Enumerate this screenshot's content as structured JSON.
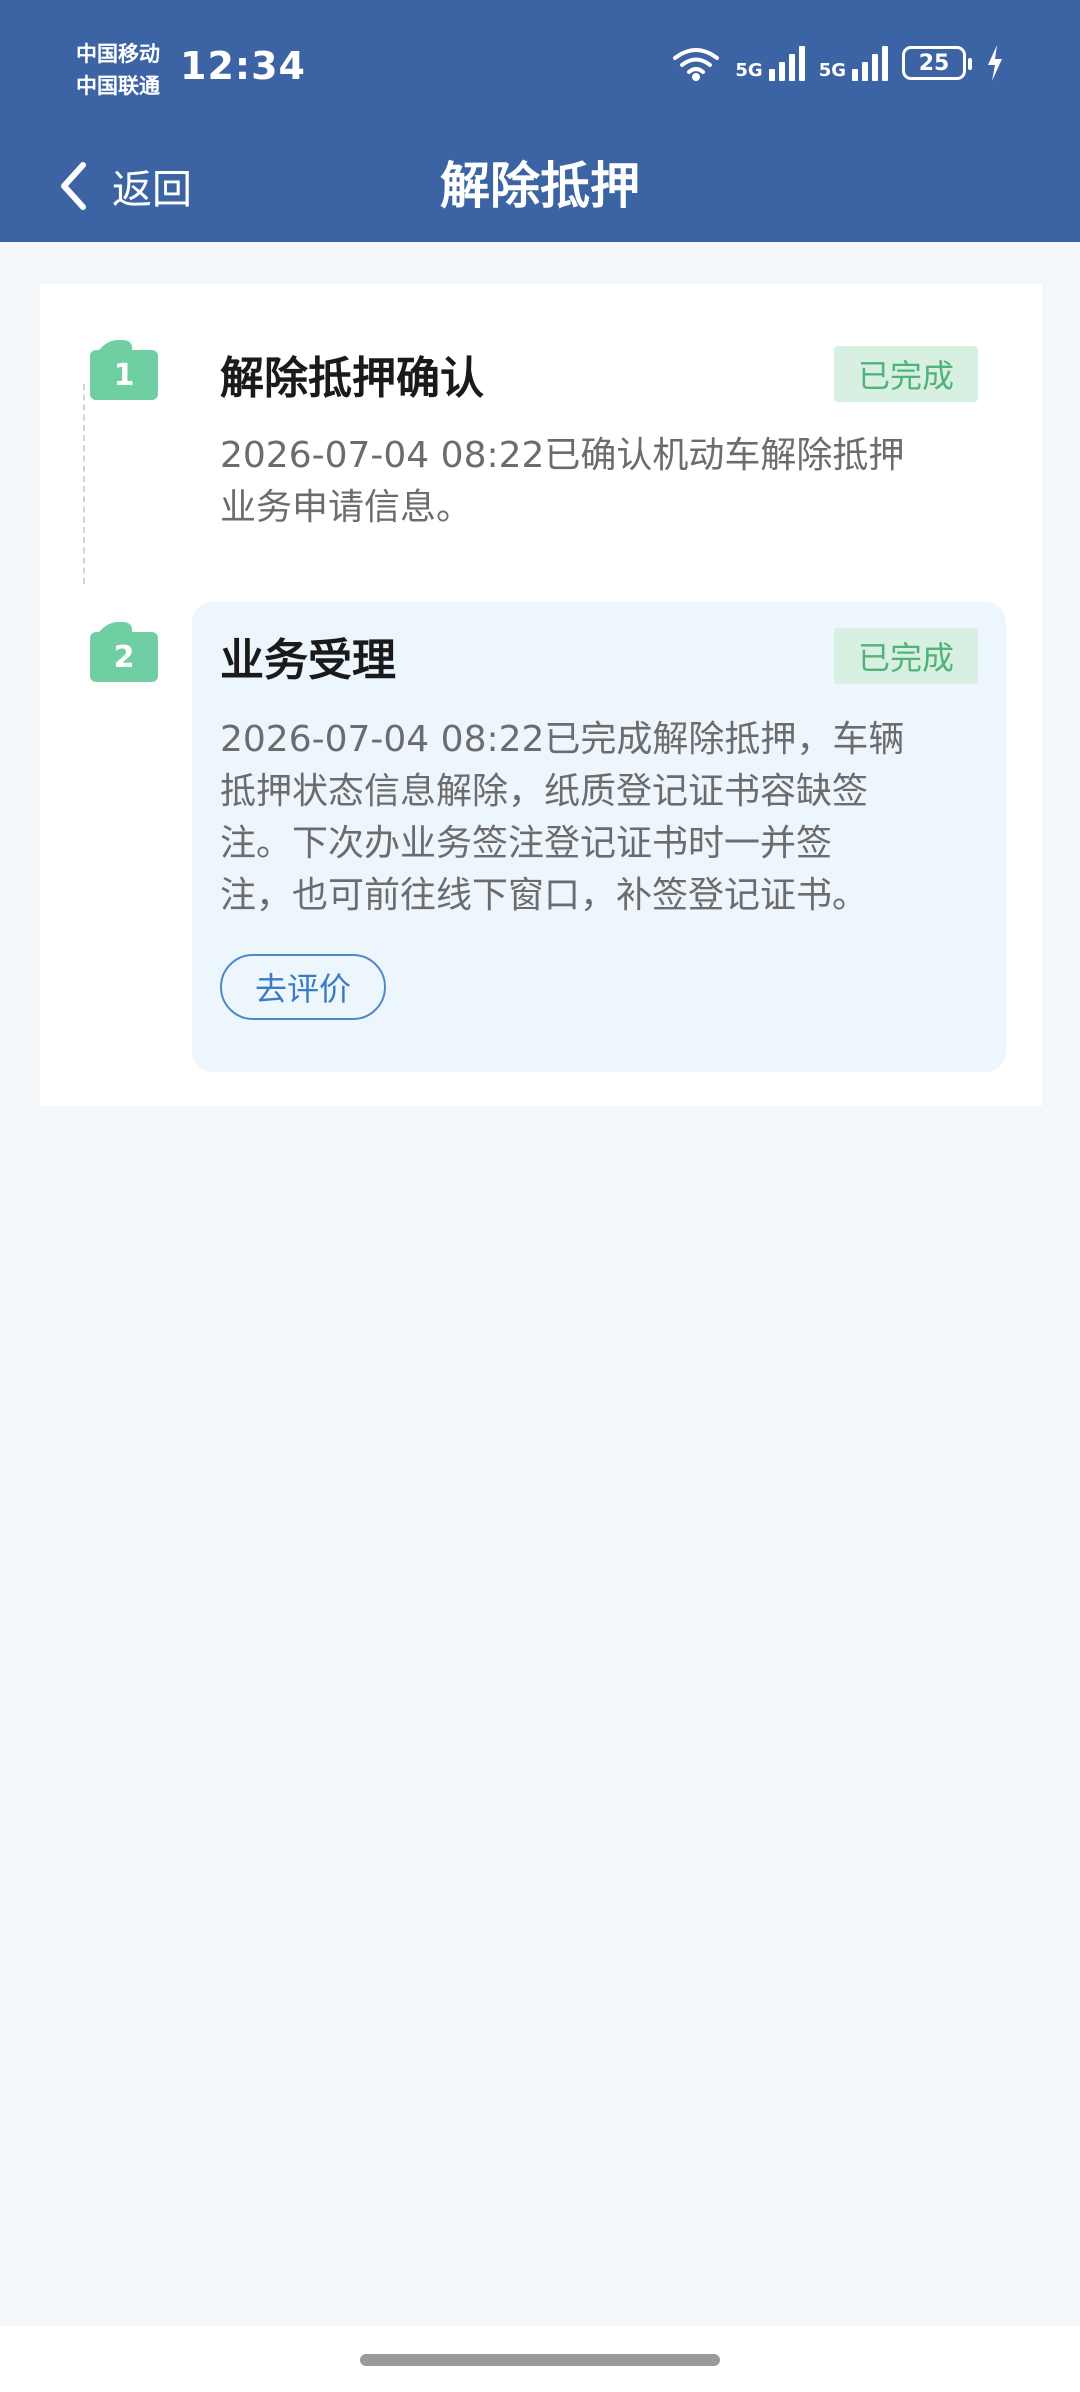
{
  "status_bar": {
    "carrier_1": "中国移动",
    "carrier_2": "中国联通",
    "time": "12:34",
    "signal_1": "5G",
    "signal_2": "5G",
    "battery": "25"
  },
  "nav": {
    "back_label": "返回",
    "title": "解除抵押"
  },
  "steps": [
    {
      "number": "1",
      "title": "解除抵押确认",
      "status": "已完成",
      "desc_lines": [
        "2026-07-04 08:22已确认机动车解除抵押",
        "业务申请信息。"
      ]
    },
    {
      "number": "2",
      "title": "业务受理",
      "status": "已完成",
      "desc_lines": [
        "2026-07-04 08:22已完成解除抵押，车辆",
        "抵押状态信息解除，纸质登记证书容缺签",
        "注。下次办业务签注登记证书时一并签",
        "注，也可前往线下窗口，补签登记证书。"
      ],
      "action_label": "去评价"
    }
  ],
  "colors": {
    "header": "#3c64a4",
    "step_badge": "#6fcfa2",
    "status_badge_bg": "#d8f0e1",
    "status_badge_text": "#4fb37a",
    "action_button": "#3b7ac4"
  }
}
